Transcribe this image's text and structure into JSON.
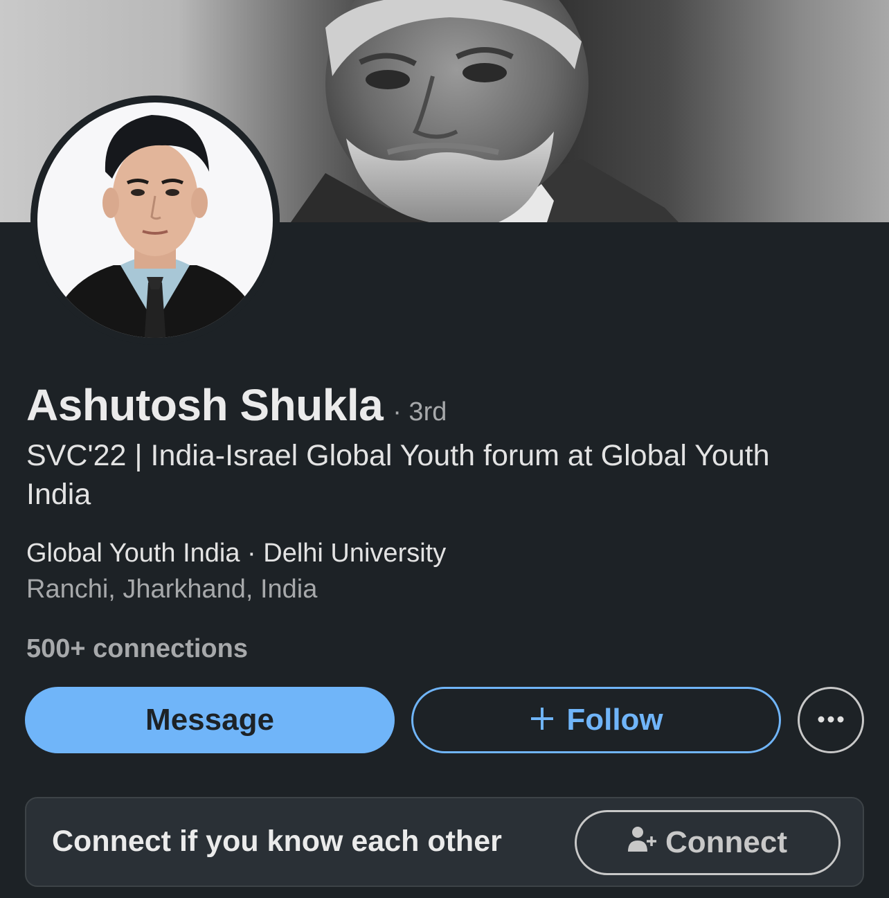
{
  "profile": {
    "name": "Ashutosh Shukla",
    "degree": "· 3rd",
    "headline": "SVC'22 | India-Israel Global Youth forum at Global Youth India",
    "company_education": "Global Youth India · Delhi University",
    "location": "Ranchi, Jharkhand, India",
    "connections": "500+ connections"
  },
  "actions": {
    "message_label": "Message",
    "follow_label": "Follow",
    "follow_icon": "plus-icon",
    "more_icon": "ellipsis-icon"
  },
  "connect_card": {
    "prompt": "Connect if you know each other",
    "button_label": "Connect",
    "button_icon": "add-person-icon"
  },
  "colors": {
    "background": "#1d2226",
    "accent": "#70b5f9",
    "text_primary": "#ebebeb",
    "text_secondary": "#a7a9ab",
    "card_background": "#2a3036"
  }
}
